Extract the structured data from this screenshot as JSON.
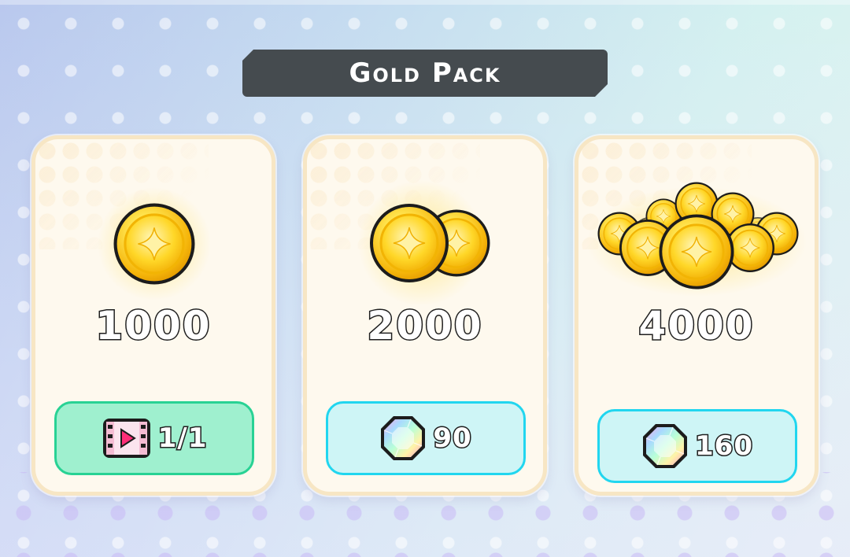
{
  "title": "Gold Pack",
  "colors": {
    "banner": "#454b4f",
    "card_bg": "#fef9ee",
    "card_border": "#f7e6c4",
    "gold": "#f7c61a",
    "free_button": "#9ff0cf",
    "free_button_border": "#28d294",
    "gem_button": "#cef5f6",
    "gem_button_border": "#21d6ef"
  },
  "packs": [
    {
      "amount": "1000",
      "icon": "single-gold-coin-icon",
      "price": {
        "label": "1/1",
        "currency_icon": "video-ad-icon",
        "style": "free"
      }
    },
    {
      "amount": "2000",
      "icon": "two-gold-coins-icon",
      "price": {
        "label": "90",
        "currency_icon": "rainbow-gem-icon",
        "style": "gem"
      }
    },
    {
      "amount": "4000",
      "icon": "gold-coin-pile-icon",
      "price": {
        "label": "160",
        "currency_icon": "rainbow-gem-icon",
        "style": "gem"
      }
    }
  ]
}
